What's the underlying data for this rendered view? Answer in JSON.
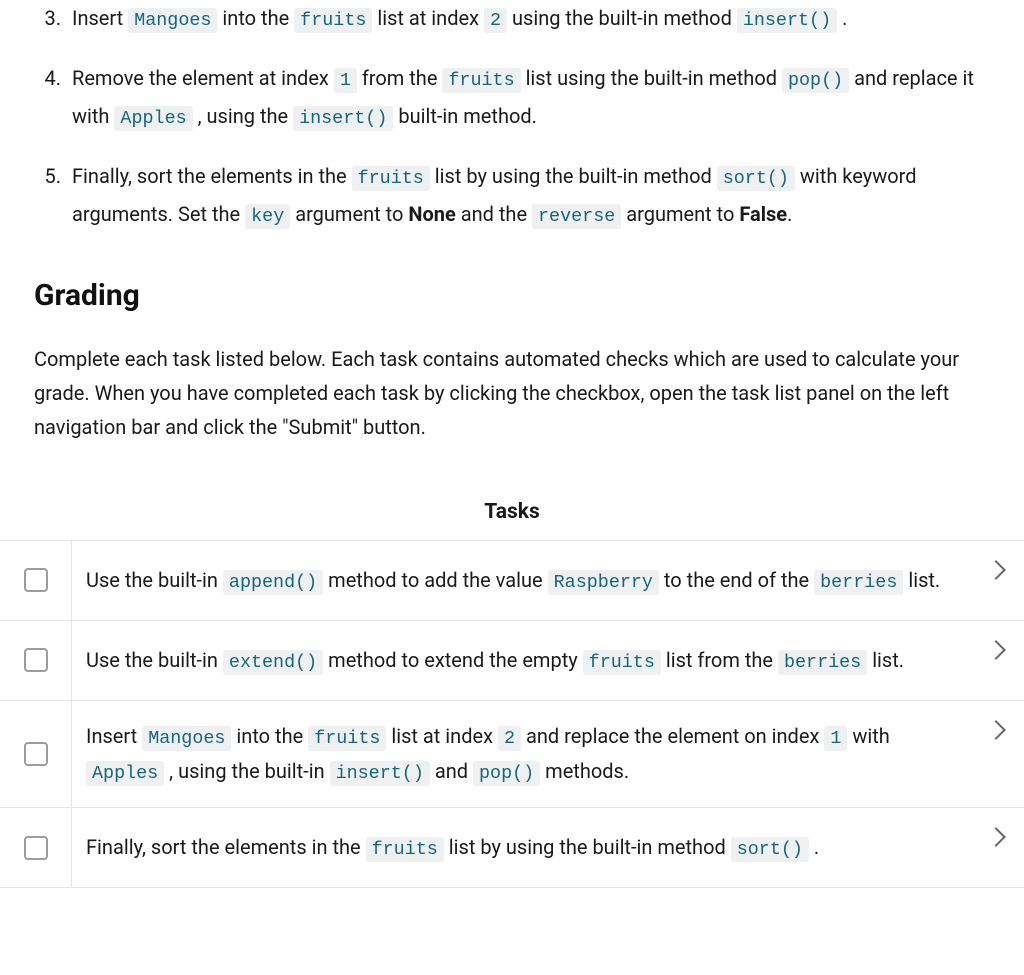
{
  "steps": [
    {
      "num": "3",
      "parts": [
        {
          "t": "Insert "
        },
        {
          "c": "Mangoes"
        },
        {
          "t": " into the "
        },
        {
          "c": "fruits"
        },
        {
          "t": " list at index "
        },
        {
          "c": "2"
        },
        {
          "t": " using the built-in method "
        },
        {
          "c": "insert()"
        },
        {
          "t": " ."
        }
      ]
    },
    {
      "num": "4",
      "parts": [
        {
          "t": "Remove the element at index "
        },
        {
          "c": "1"
        },
        {
          "t": " from the "
        },
        {
          "c": "fruits"
        },
        {
          "t": " list using the built-in method "
        },
        {
          "c": "pop()"
        },
        {
          "t": " and replace it with "
        },
        {
          "c": "Apples"
        },
        {
          "t": " , using the "
        },
        {
          "c": "insert()"
        },
        {
          "t": " built-in method."
        }
      ]
    },
    {
      "num": "5",
      "parts": [
        {
          "t": "Finally, sort the elements in the "
        },
        {
          "c": "fruits"
        },
        {
          "t": " list by using the built-in method "
        },
        {
          "c": "sort()"
        },
        {
          "t": " with keyword arguments. Set the "
        },
        {
          "c": "key"
        },
        {
          "t": " argument to "
        },
        {
          "b": "None"
        },
        {
          "t": " and the "
        },
        {
          "c": "reverse"
        },
        {
          "t": " argument to "
        },
        {
          "b": "False"
        },
        {
          "t": "."
        }
      ]
    }
  ],
  "grading_heading": "Grading",
  "grading_desc": "Complete each task listed below. Each task contains automated checks which are used to calculate your grade. When you have completed each task by clicking the checkbox, open the task list panel on the left navigation bar and click the \"Submit\" button.",
  "tasks_heading": "Tasks",
  "tasks": [
    {
      "parts": [
        {
          "t": "Use the built-in "
        },
        {
          "c": "append()"
        },
        {
          "t": " method to add the value "
        },
        {
          "c": "Raspberry"
        },
        {
          "t": " to the end of the "
        },
        {
          "c": "berries"
        },
        {
          "t": " list."
        }
      ]
    },
    {
      "parts": [
        {
          "t": "Use the built-in "
        },
        {
          "c": "extend()"
        },
        {
          "t": " method to extend the empty "
        },
        {
          "c": "fruits"
        },
        {
          "t": " list from the "
        },
        {
          "c": "berries"
        },
        {
          "t": " list."
        }
      ]
    },
    {
      "parts": [
        {
          "t": "Insert "
        },
        {
          "c": "Mangoes"
        },
        {
          "t": " into the "
        },
        {
          "c": "fruits"
        },
        {
          "t": " list at index "
        },
        {
          "c": "2"
        },
        {
          "t": " and replace the element on index "
        },
        {
          "c": "1"
        },
        {
          "t": " with "
        },
        {
          "c": "Apples"
        },
        {
          "t": " , using the built-in "
        },
        {
          "c": "insert()"
        },
        {
          "t": " and "
        },
        {
          "c": "pop()"
        },
        {
          "t": " methods."
        }
      ]
    },
    {
      "parts": [
        {
          "t": "Finally, sort the elements in the "
        },
        {
          "c": "fruits"
        },
        {
          "t": " list by using the built-in method "
        },
        {
          "c": "sort()"
        },
        {
          "t": " ."
        }
      ]
    }
  ]
}
